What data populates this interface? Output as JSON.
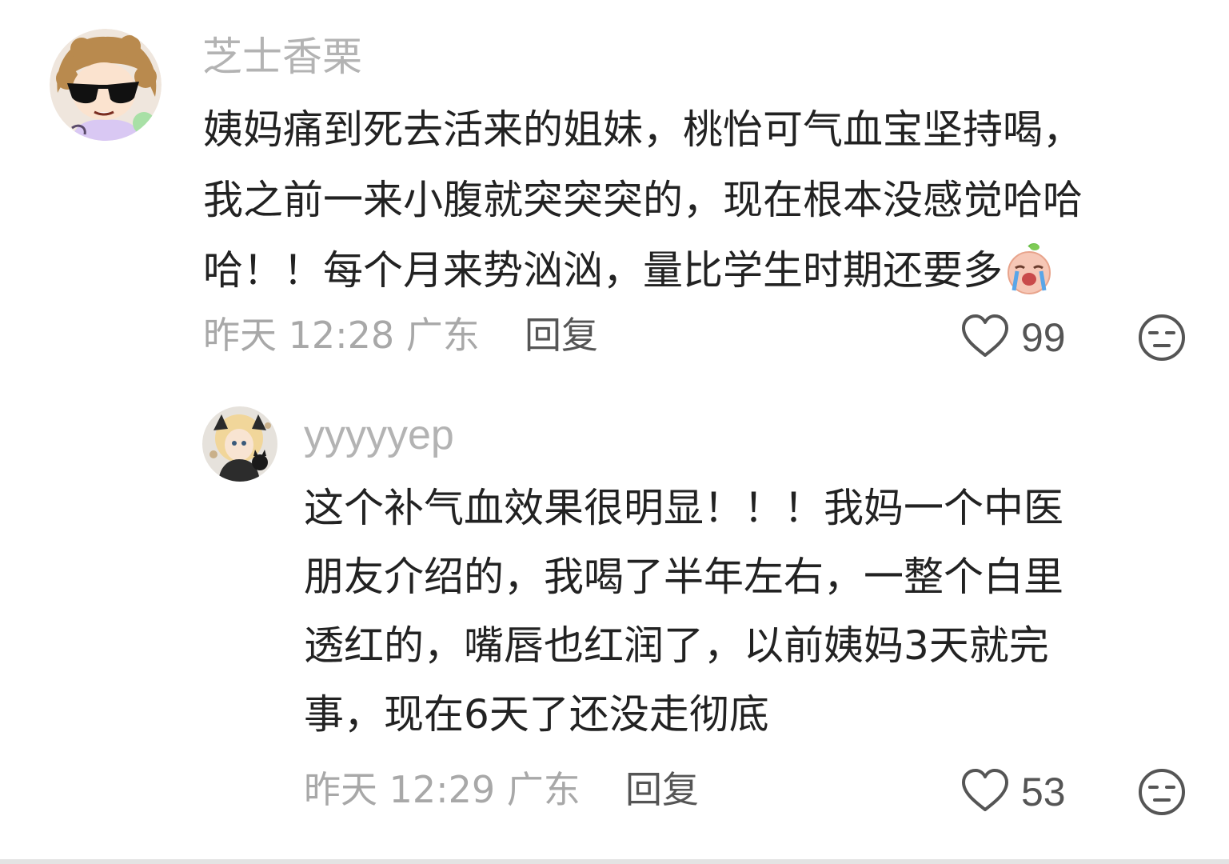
{
  "comments": [
    {
      "username": "芝士香栗",
      "lines": [
        "姨妈痛到死去活来的姐妹，桃怡可气血宝坚持喝，",
        "我之前一来小腹就突突突的，现在根本没感觉哈哈",
        "哈！！每个月来势汹汹，量比学生时期还要多"
      ],
      "time": "昨天 12:28 广东",
      "reply_label": "回复",
      "likes": "99",
      "inline_emoji": "crying-emoji"
    },
    {
      "username": "yyyyyep",
      "lines": [
        "这个补气血效果很明显！！！我妈一个中医",
        "朋友介绍的，我喝了半年左右，一整个白里",
        "透红的，嘴唇也红润了，以前姨妈3天就完",
        "事，现在6天了还没走彻底"
      ],
      "time": "昨天 12:29 广东",
      "reply_label": "回复",
      "likes": "53"
    }
  ],
  "colors": {
    "username": "#b3b3b3",
    "text": "#222222",
    "meta": "#a8a8a8",
    "action": "#555555"
  },
  "icons": [
    "heart-icon",
    "dislike-face-icon",
    "crying-emoji"
  ]
}
